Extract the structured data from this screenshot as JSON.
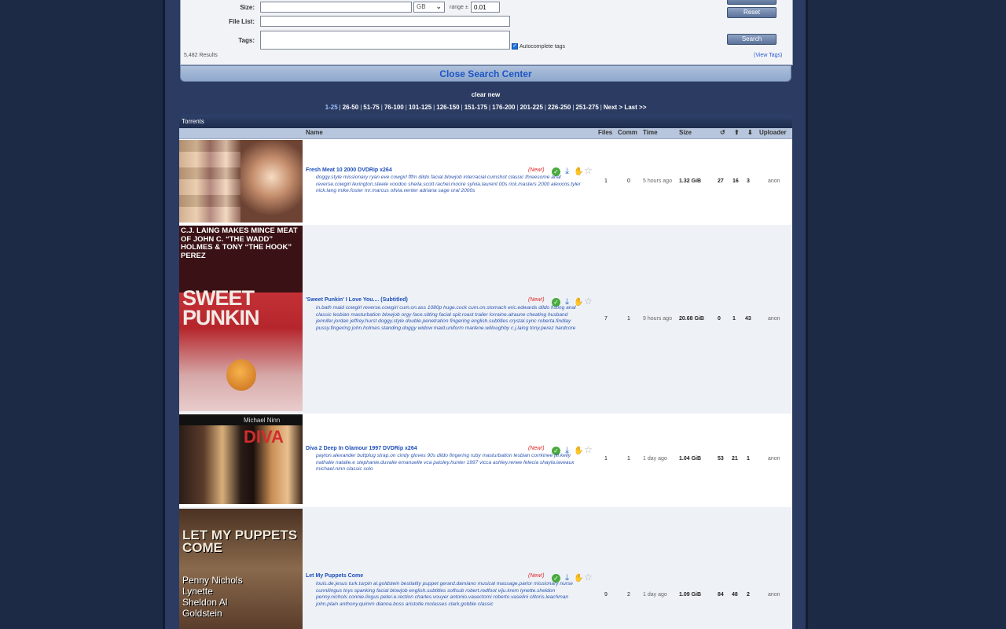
{
  "search": {
    "size_label": "Size:",
    "size_unit": "GB",
    "range_label": "range ±",
    "range_value": "0.01",
    "filelist_label": "File List:",
    "tags_label": "Tags:",
    "autocomplete_label": "Autocomplete tags",
    "reset_label": "Reset",
    "search_label": "Search",
    "results_count": "5,482 Results",
    "view_tags": "(View Tags)",
    "close_label": "Close Search Center"
  },
  "clear_new": "clear new",
  "pager": [
    "1-25",
    "26-50",
    "51-75",
    "76-100",
    "101-125",
    "126-150",
    "151-175",
    "176-200",
    "201-225",
    "226-250",
    "251-275",
    "Next >",
    "Last >>"
  ],
  "table": {
    "title": "Torrents",
    "headers": {
      "name": "Name",
      "files": "Files",
      "comm": "Comm",
      "time": "Time",
      "size": "Size",
      "uploader": "Uploader"
    },
    "rows": [
      {
        "name": "Fresh Meat 10 2000 DVDRip x264",
        "new": "(New!)",
        "tags": "doggy.style missionary ryan eve cowgirl fffm dildo facial blowjob interracial cumshot classic threesome anal reverse.cowgirl lexington.steele voodoo sheila.scott rachel.moore sylvia.laurent 00s rick.masters 2000 alexxxis.tyler nick.lang mike.foster mr.marcus olivia.venter adriana sage oral 2000s",
        "files": "1",
        "comm": "0",
        "time": "5 hours ago",
        "size": "1.32 GiB",
        "snatched": "27",
        "seeders": "16",
        "leechers": "3",
        "uploader": "anon",
        "thumb_caption": ""
      },
      {
        "name": "'Sweet Punkin' I Love You.... (Subtitled)",
        "new": "(New!)",
        "tags": "in.bath maid cowgirl reverse.cowgirl cum.on.ass 1080p huge.cock cum.on.stomach eric.edwards dildo fisting anal classic lesbian masturbation blowjob orgy face.sitting facial spit.roast trailer lorraine.alraune cheating husband jennifer.jordan jeffrey.hurst doggy.style double.penetration fingering english.subtitles crystal.sync roberta.findlay pussy.fingering john.holmes standing.doggy widow maid.uniform marlene.willoughby c.j.laing tony.perez hardcore",
        "files": "7",
        "comm": "1",
        "time": "9 hours ago",
        "size": "20.68 GiB",
        "snatched": "0",
        "seeders": "1",
        "leechers": "43",
        "uploader": "anon",
        "thumb_caption": "C.J. LAING MAKES MINCE MEAT OF JOHN C. “THE WADD” HOLMES & TONY “THE HOOK” PEREZ",
        "thumb_title": "SWEET PUNKIN"
      },
      {
        "name": "Diva 2 Deep In Glamour 1997 DVDRip x264",
        "new": "(New!)",
        "tags": "payton.alexander buttplug strap.on cindy gloves 90s dildo fingering ruby masturbation lesbian corrkinee jill.kelly nathalie natalie.e stephanie.duvalie emanuelle vca paisley.hunter 1997 vicca ashley.renee felecia shayla.laveaux michael.ninn classic solo",
        "files": "1",
        "comm": "1",
        "time": "1 day ago",
        "size": "1.04 GiB",
        "snatched": "53",
        "seeders": "21",
        "leechers": "1",
        "uploader": "anon",
        "thumb_title": "DIVA",
        "thumb_sub": "Michael Ninn"
      },
      {
        "name": "Let My Puppets Come",
        "new": "(New!)",
        "tags": "louis.de.jesus turk.turpin al.goldstein bestiality puppet gerard.damiano musical massage.parlor missionary nurse cunnilingus toys spanking facial blowjob english.subtitles softsub robert.redfoot viju.krem lynette.sheldon penny.nichols connie.lingus peter.e.rection charles.vouyer antonio.vasectomi roberto.vaselini clitoris.leachman john.plain anthony.quimm dianna.boss aristotle.molasses clark.gobble classic",
        "files": "9",
        "comm": "2",
        "time": "1 day ago",
        "size": "1.09 GiB",
        "snatched": "84",
        "seeders": "48",
        "leechers": "2",
        "uploader": "anon",
        "thumb_title": "LET MY PUPPETS COME",
        "thumb_names": "Penny Nichols Lynette Sheldon Al Goldstein"
      }
    ]
  }
}
